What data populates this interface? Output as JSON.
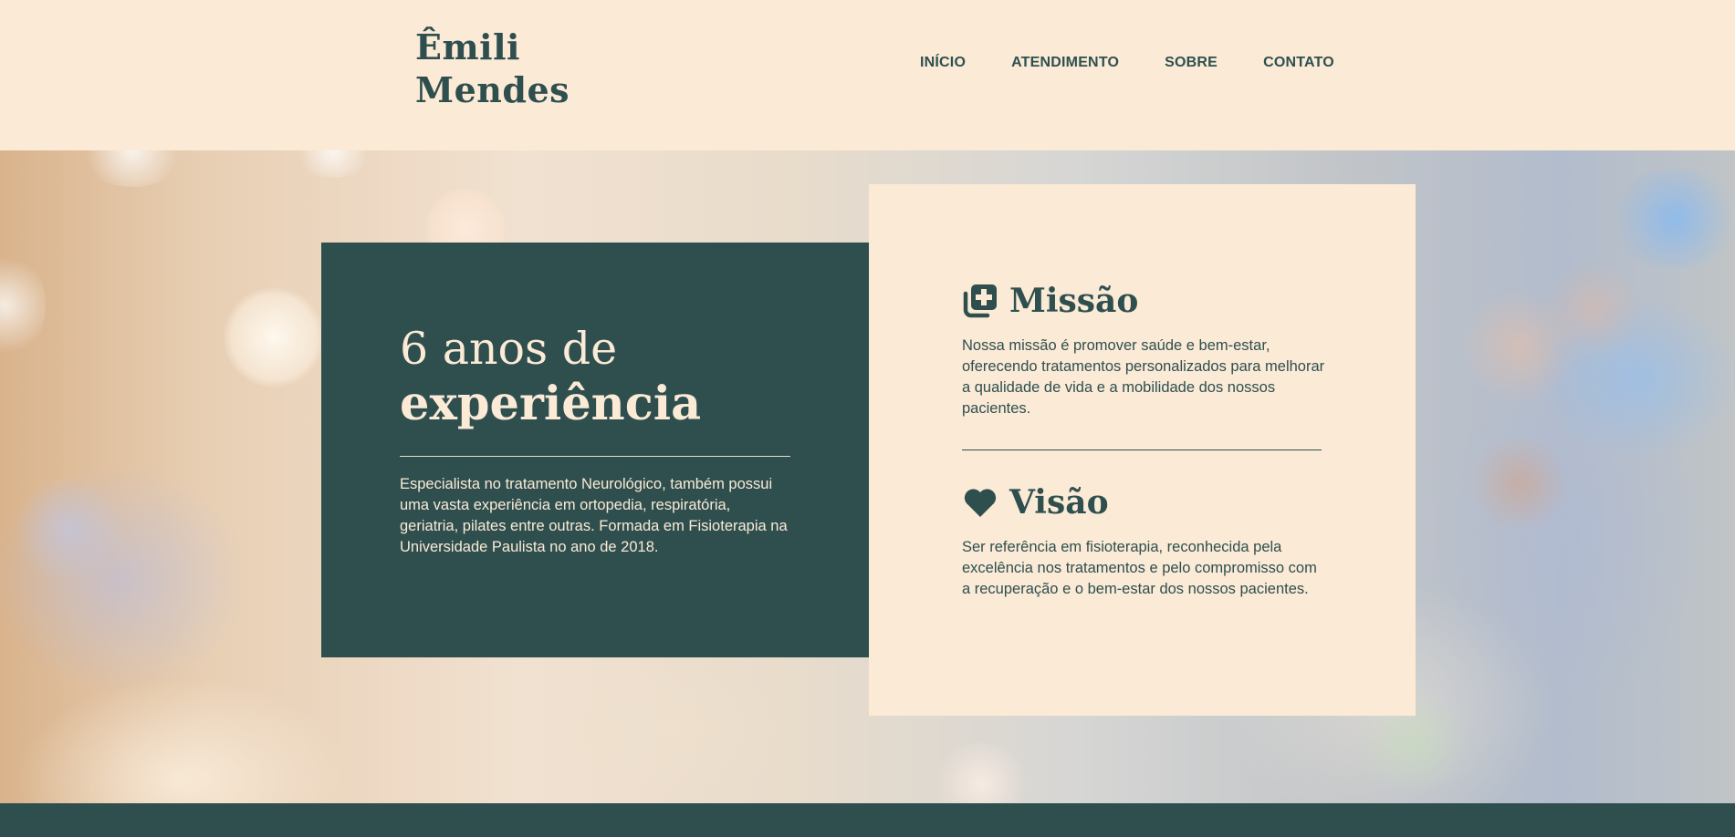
{
  "header": {
    "logo_line1": "Êmili",
    "logo_line2": "Mendes",
    "nav": [
      "INÍCIO",
      "ATENDIMENTO",
      "SOBRE",
      "CONTATO"
    ]
  },
  "experience": {
    "title_line1": "6 anos de",
    "title_line2": "experiência",
    "text": "Especialista no tratamento Neurológico, também possui uma vasta experiência em ortopedia, respiratória, geriatria, pilates entre outras. Formada em Fisioterapia na Universidade Paulista no ano de 2018."
  },
  "mission": {
    "icon": "medical-plus-icon",
    "title": "Missão",
    "text": "Nossa missão é promover saúde e bem-estar, oferecendo tratamentos personalizados para melhorar a qualidade de vida e a mobilidade dos nossos pacientes."
  },
  "vision": {
    "icon": "heart-icon",
    "title": "Visão",
    "text": "Ser referência em fisioterapia, reconhecida pela excelência nos tratamentos e pelo compromisso com a recuperação e o bem-estar dos nossos pacientes."
  },
  "colors": {
    "primary": "#2f4f4f",
    "cream": "#faead6"
  }
}
